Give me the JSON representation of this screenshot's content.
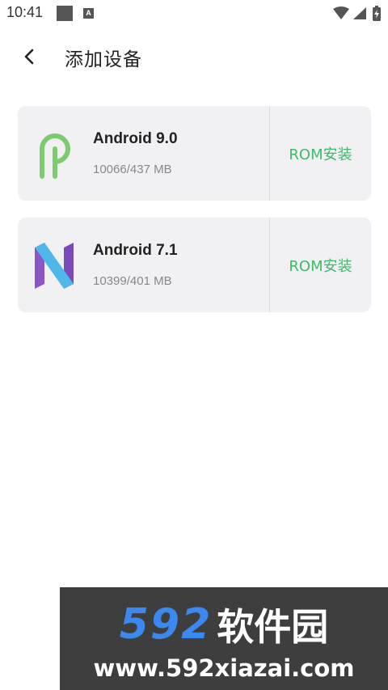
{
  "status_bar": {
    "time": "10:41",
    "icons": [
      "notification-square-icon",
      "a-icon",
      "wifi-icon",
      "signal-icon",
      "battery-charging-icon"
    ]
  },
  "header": {
    "title": "添加设备",
    "back_icon": "chevron-left-icon"
  },
  "devices": [
    {
      "name": "Android 9.0",
      "meta": "10066/437 MB",
      "action": "ROM安装",
      "logo": "android-p-logo"
    },
    {
      "name": "Android 7.1",
      "meta": "10399/401 MB",
      "action": "ROM安装",
      "logo": "android-n-logo"
    }
  ],
  "watermark": {
    "number": "592",
    "name": "软件园",
    "url": "www.592xiazai.com"
  },
  "colors": {
    "accent": "#3dbb6b",
    "card_bg": "#f1f1f4",
    "watermark_bg": "#3e3e3e",
    "watermark_blue": "#3b88ee"
  }
}
